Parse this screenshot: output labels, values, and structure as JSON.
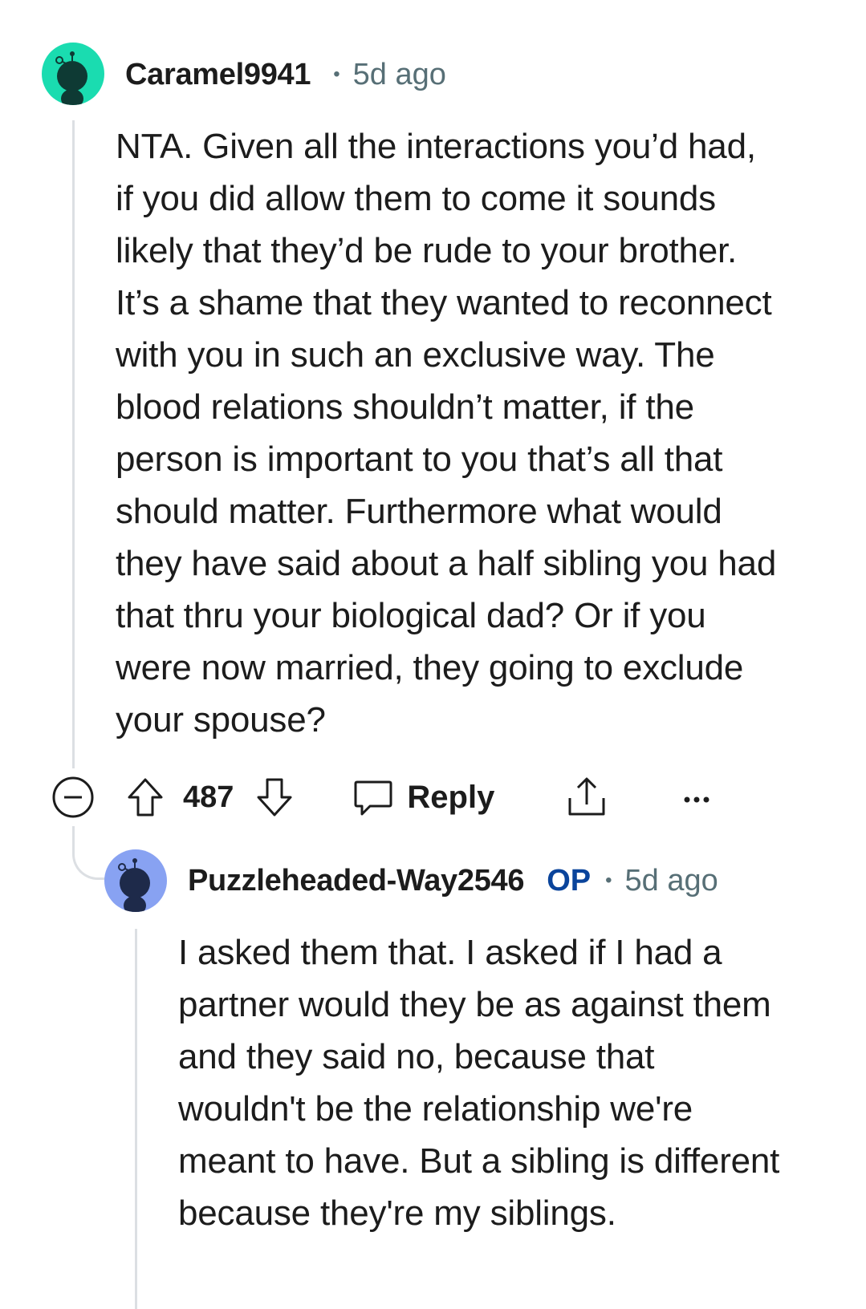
{
  "comments": [
    {
      "username": "Caramel9941",
      "timestamp": "5d ago",
      "avatar_color": "#1adcb0",
      "body": "NTA. Given all the interactions you’d had, if you did allow them to come it sounds likely that they’d be rude to your brother. It’s a shame that they wanted to reconnect with you in such an exclusive way. The blood relations shouldn’t matter, if the person is important to you that’s all that should matter. Furthermore what would they have said about a half sibling you had that thru your biological dad? Or if you were now married, they going to exclude your spouse?",
      "actions": {
        "collapse_icon": "minus-circle-icon",
        "upvote_icon": "upvote-arrow-icon",
        "score": "487",
        "downvote_icon": "downvote-arrow-icon",
        "reply_icon": "speech-bubble-icon",
        "reply_label": "Reply",
        "share_icon": "share-icon",
        "more_icon": "ellipsis-icon"
      }
    },
    {
      "username": "Puzzleheaded-Way2546",
      "op_badge": "OP",
      "timestamp": "5d ago",
      "avatar_color": "#88a2f2",
      "body": "I asked them that. I asked if I had a partner would they be as against them and they said no, because that wouldn't be the relationship we're meant to have. But a sibling is different because they're my siblings."
    }
  ],
  "separator": "•"
}
